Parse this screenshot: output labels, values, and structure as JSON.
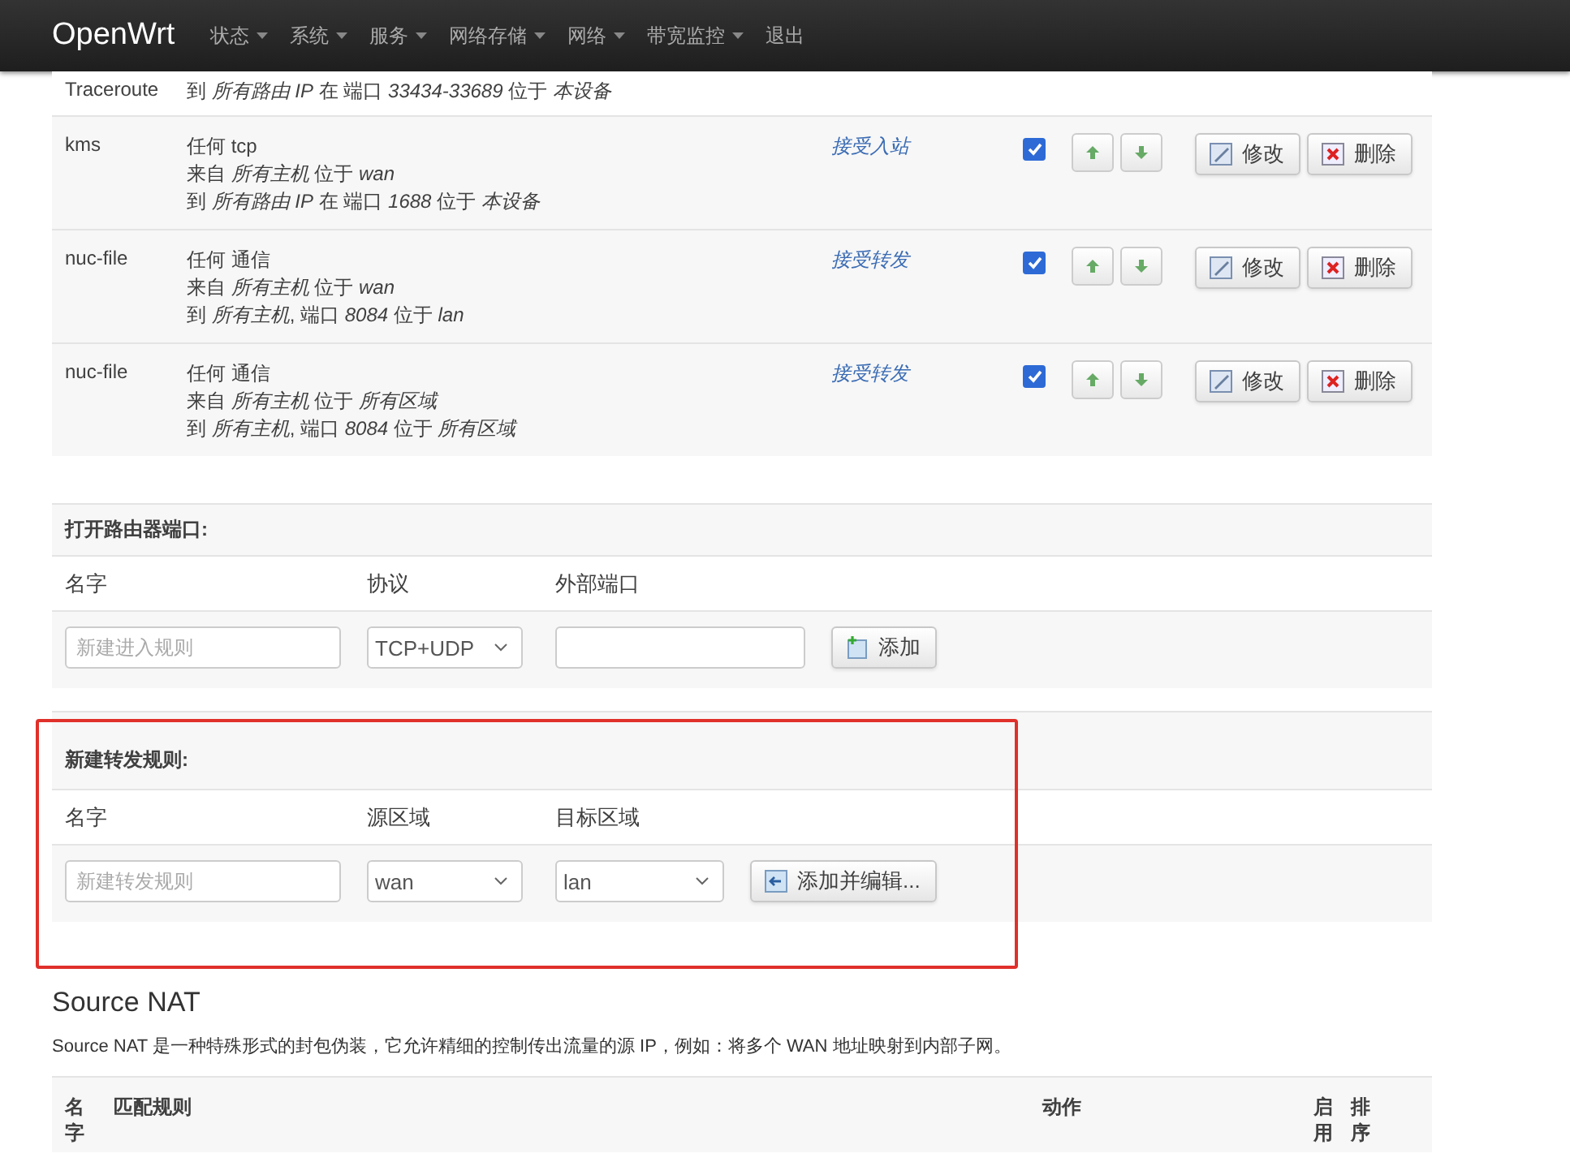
{
  "navbar": {
    "brand": "OpenWrt",
    "menu": [
      {
        "label": "状态",
        "dropdown": true
      },
      {
        "label": "系统",
        "dropdown": true
      },
      {
        "label": "服务",
        "dropdown": true
      },
      {
        "label": "网络存储",
        "dropdown": true
      },
      {
        "label": "网络",
        "dropdown": true
      },
      {
        "label": "带宽监控",
        "dropdown": true
      },
      {
        "label": "退出",
        "dropdown": false
      }
    ]
  },
  "rules": [
    {
      "name": "Traceroute",
      "match": [
        "到 *所有路由 IP* 在 端口 *33434-33689* 位于 *本设备*"
      ]
    },
    {
      "name": "kms",
      "match": [
        "任何 tcp",
        "来自 *所有主机* 位于 *wan*",
        "到 *所有路由 IP* 在 端口 *1688* 位于 *本设备*"
      ],
      "action": "接受入站",
      "enabled": true,
      "edit": "修改",
      "delete": "删除"
    },
    {
      "name": "nuc-file",
      "match": [
        "任何 通信",
        "来自 *所有主机* 位于 *wan*",
        "到 *所有主机*, 端口 *8084* 位于 *lan*"
      ],
      "action": "接受转发",
      "enabled": true,
      "edit": "修改",
      "delete": "删除"
    },
    {
      "name": "nuc-file",
      "match": [
        "任何 通信",
        "来自 *所有主机* 位于 *所有区域*",
        "到 *所有主机*, 端口 *8084* 位于 *所有区域*"
      ],
      "action": "接受转发",
      "enabled": true,
      "edit": "修改",
      "delete": "删除"
    }
  ],
  "open_port": {
    "title": "打开路由器端口:",
    "columns": [
      "名字",
      "协议",
      "外部端口"
    ],
    "name_field": {
      "placeholder": "新建进入规则"
    },
    "protocol": "TCP+UDP",
    "button": "添加"
  },
  "new_forward": {
    "title": "新建转发规则:",
    "columns": [
      "名字",
      "源区域",
      "目标区域"
    ],
    "name_field": {
      "placeholder": "新建转发规则"
    },
    "source_zone": "wan",
    "dest_zone": "lan",
    "button": "添加并编辑...",
    "highlighted": true
  },
  "source_nat": {
    "title": "Source NAT",
    "description": "Source NAT 是一种特殊形式的封包伪装，它允许精细的控制传出流量的源 IP，例如：将多个 WAN 地址映射到内部子网。",
    "columns": [
      "名字",
      "匹配规则",
      "动作",
      "启用",
      "排序"
    ]
  }
}
